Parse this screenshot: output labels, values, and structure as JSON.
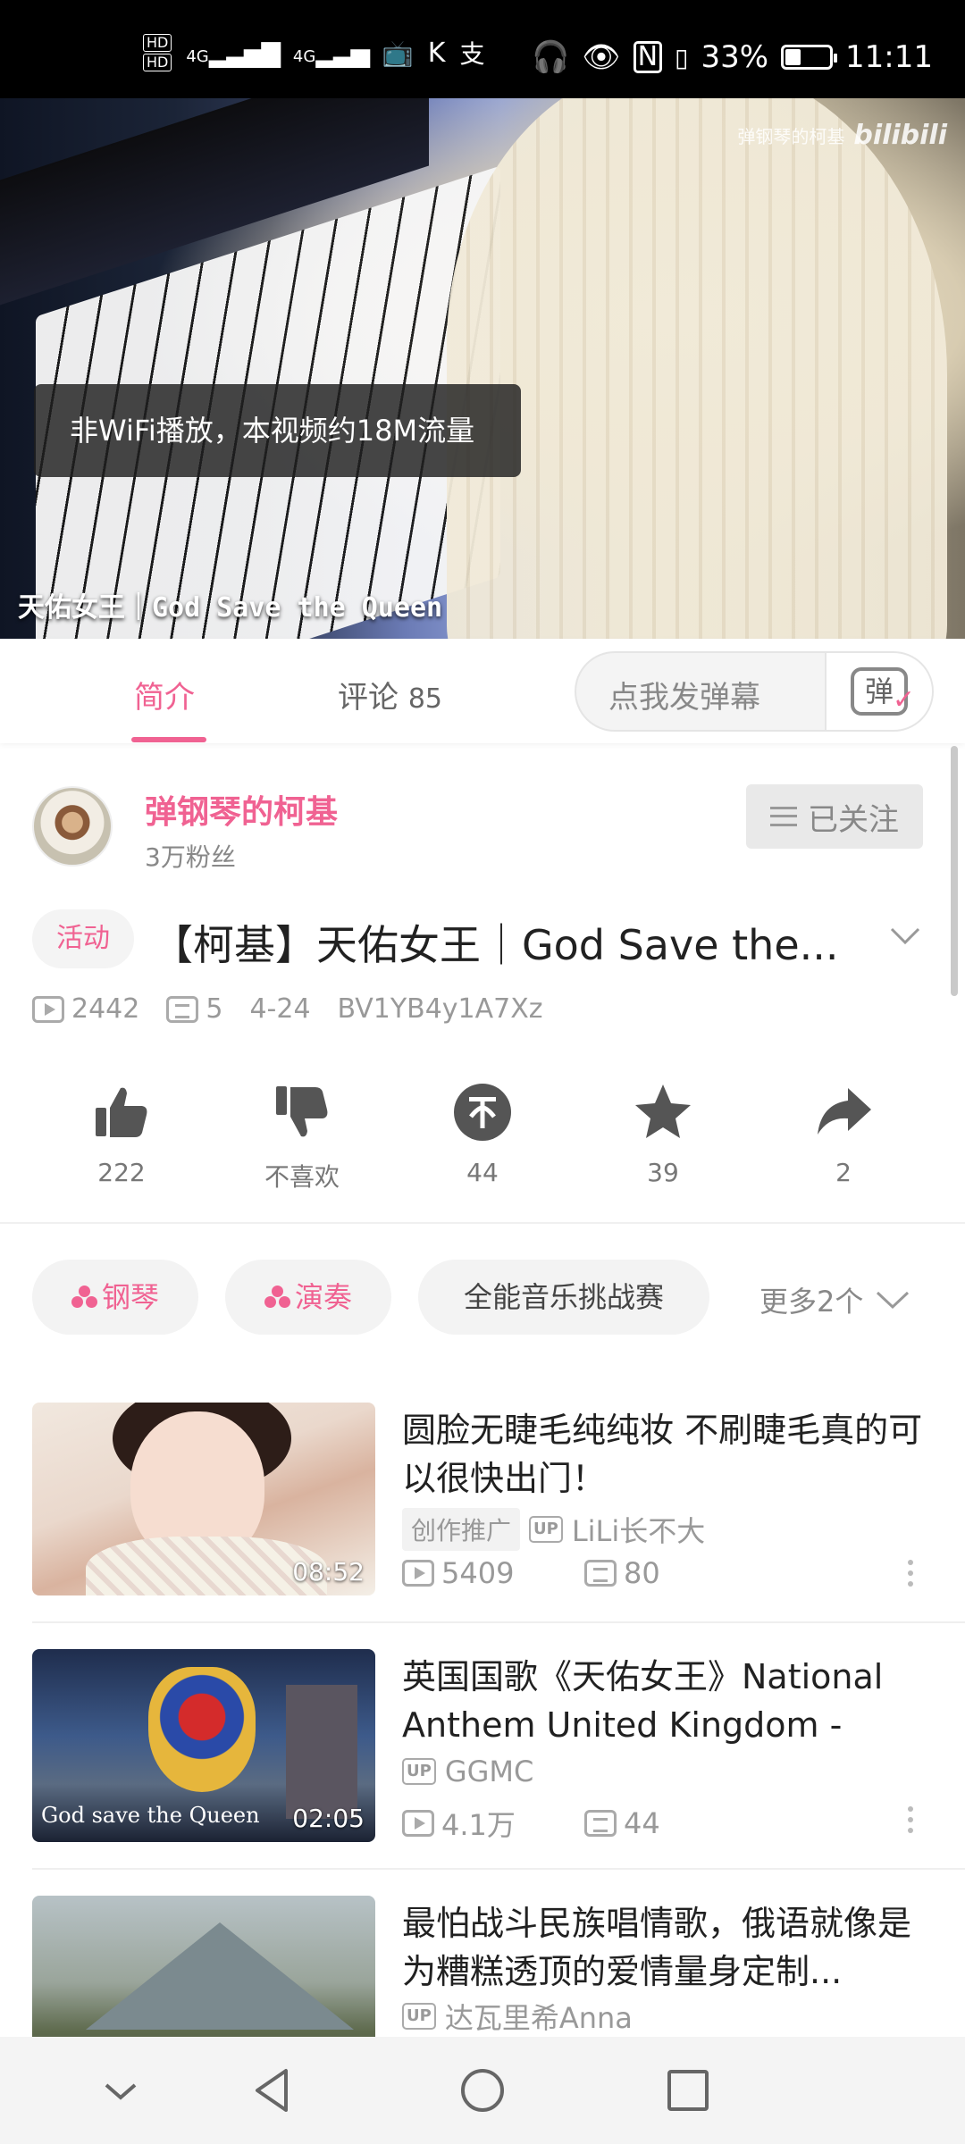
{
  "status_bar": {
    "network": "4G",
    "battery_percent": "33%",
    "battery_level": 0.33,
    "time": "11:11"
  },
  "video": {
    "watermark_text": "弹钢琴的柯基",
    "watermark_logo": "bilibili",
    "toast": "非WiFi播放，本视频约18M流量",
    "caption": "天佑女王｜God Save the Queen"
  },
  "tabs": {
    "intro": "简介",
    "comments": "评论",
    "comments_count": "85",
    "danmaku_placeholder": "点我发弹幕",
    "danmaku_button": "弹"
  },
  "uploader": {
    "name": "弹钢琴的柯基",
    "fans": "3万粉丝",
    "follow_label": "已关注"
  },
  "video_info": {
    "badge": "活动",
    "title": "【柯基】天佑女王｜God Save the...",
    "views": "2442",
    "danmaku": "5",
    "date": "4-24",
    "bvid": "BV1YB4y1A7Xz"
  },
  "actions": {
    "like": "222",
    "dislike": "不喜欢",
    "coin": "44",
    "favorite": "39",
    "share": "2"
  },
  "tags": {
    "items": [
      "钢琴",
      "演奏",
      "全能音乐挑战赛"
    ],
    "more": "更多2个"
  },
  "recommendations": [
    {
      "title": "圆脸无睫毛纯纯妆 不刷睫毛真的可以很快出门！",
      "duration": "08:52",
      "promo": "创作推广",
      "uploader": "LiLi长不大",
      "views": "5409",
      "danmaku": "80"
    },
    {
      "title": "英国国歌《天佑女王》National Anthem United Kingdom - God...",
      "duration": "02:05",
      "thumb_caption": "God save the Queen",
      "uploader": "GGMC",
      "views": "4.1万",
      "danmaku": "44"
    },
    {
      "title": "最怕战斗民族唱情歌，俄语就像是为糟糕透顶的爱情量身定制...",
      "uploader": "达瓦里希Anna"
    }
  ],
  "up_tag": "UP",
  "colors": {
    "accent": "#f06292",
    "text": "#212121",
    "muted": "#999999"
  },
  "icons": [
    "like-icon",
    "dislike-icon",
    "coin-icon",
    "favorite-icon",
    "share-icon",
    "play-count-icon",
    "danmaku-count-icon"
  ]
}
